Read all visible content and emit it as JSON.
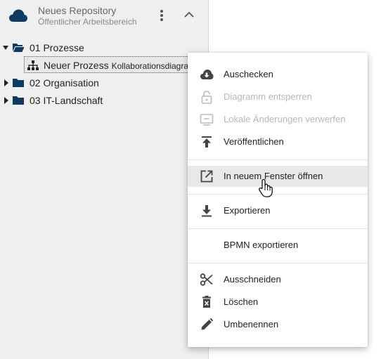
{
  "repository": {
    "title": "Neues Repository",
    "subtitle": "Öffentlicher Arbeitsbereich",
    "accent_color": "#0d3b63"
  },
  "tree": {
    "items": [
      {
        "label": "01 Prozesse",
        "expanded": true,
        "icon": "folder-open-icon"
      },
      {
        "label": "Neuer Prozess",
        "sublabel": "Kollaborationsdiagra...",
        "icon": "hierarchy-icon",
        "selected": true
      },
      {
        "label": "02 Organisation",
        "expanded": false,
        "icon": "folder-icon"
      },
      {
        "label": "03 IT-Landschaft",
        "expanded": false,
        "icon": "folder-icon"
      }
    ]
  },
  "context_menu": {
    "items": [
      {
        "label": "Auschecken",
        "icon": "cloud-download-icon",
        "disabled": false
      },
      {
        "label": "Diagramm entsperren",
        "icon": "unlock-icon",
        "disabled": true
      },
      {
        "label": "Lokale Änderungen verwerfen",
        "icon": "discard-icon",
        "disabled": true
      },
      {
        "label": "Veröffentlichen",
        "icon": "publish-icon",
        "disabled": false
      },
      {
        "label": "In neuem Fenster öffnen",
        "icon": "open-in-new-icon",
        "disabled": false,
        "hovered": true
      },
      {
        "label": "Exportieren",
        "icon": "download-icon",
        "disabled": false
      },
      {
        "label": "BPMN exportieren",
        "icon": "",
        "disabled": false
      },
      {
        "label": "Ausschneiden",
        "icon": "scissors-icon",
        "disabled": false
      },
      {
        "label": "Löschen",
        "icon": "trash-icon",
        "disabled": false
      },
      {
        "label": "Umbenennen",
        "icon": "pencil-icon",
        "disabled": false
      }
    ]
  }
}
